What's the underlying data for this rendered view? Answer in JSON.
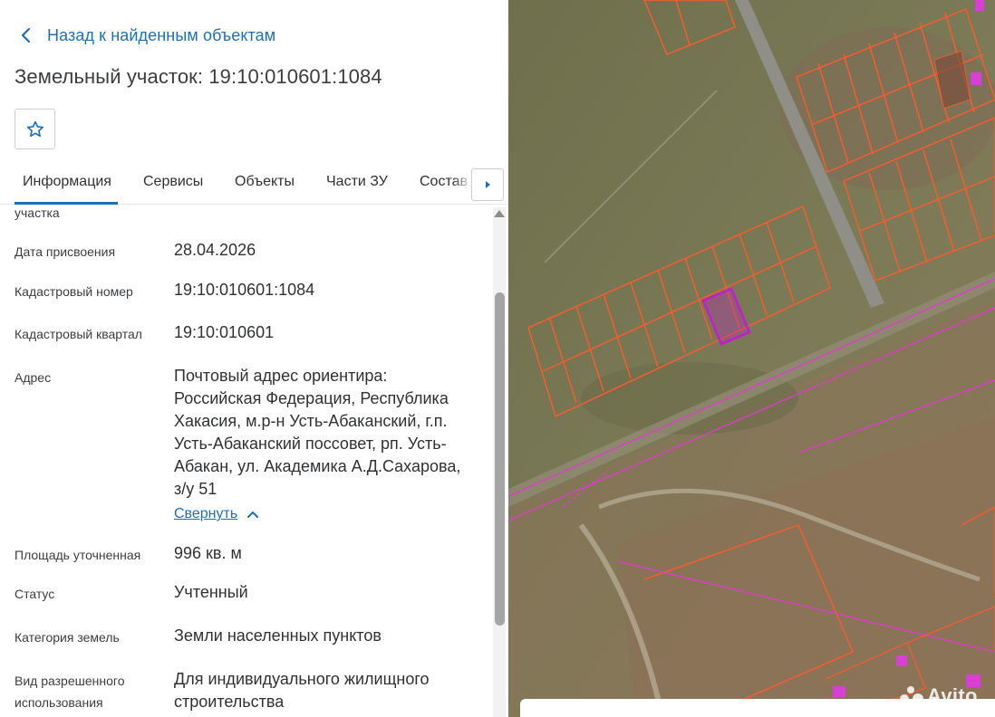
{
  "header": {
    "back_label": "Назад к найденным объектам",
    "title": "Земельный участок: 19:10:010601:1084"
  },
  "tabs": [
    {
      "label": "Информация",
      "active": true
    },
    {
      "label": "Сервисы"
    },
    {
      "label": "Объекты"
    },
    {
      "label": "Части ЗУ"
    },
    {
      "label": "Состав"
    }
  ],
  "info": {
    "cut_label": "участка",
    "rows": [
      {
        "label": "Дата присвоения",
        "value": "28.04.2026"
      },
      {
        "label": "Кадастровый номер",
        "value": "19:10:010601:1084"
      },
      {
        "label": "Кадастровый квартал",
        "value": "19:10:010601"
      },
      {
        "label": "Адрес",
        "value_lines": [
          "Почтовый адрес ориентира:",
          "Российская Федерация, Республика",
          "Хакасия, м.р-н Усть-Абаканский, г.п.",
          "Усть-Абаканский поссовет, рп. Усть-",
          "Абакан, ул. Академика А.Д.Сахарова,",
          "з/у 51"
        ]
      },
      {
        "label": "Площадь уточненная",
        "value": "996 кв. м"
      },
      {
        "label": "Статус",
        "value": "Учтенный"
      },
      {
        "label": "Категория земель",
        "value": "Земли населенных пунктов"
      },
      {
        "label_lines": [
          "Вид разрешенного",
          "использования"
        ],
        "value_lines": [
          "Для индивидуального жилищного",
          "строительства"
        ]
      }
    ],
    "collapse_label": "Свернуть"
  },
  "map": {
    "watermark": "Avito",
    "colors": {
      "parcel_outline": "#ff5a2a",
      "selected_parcel": "#c21fc8",
      "boundary_line": "#e23ad0"
    }
  },
  "icons": {
    "back": "chevron-left-icon",
    "favorite": "star-outline-icon",
    "tabs_next": "triangle-right-icon",
    "collapse": "chevron-up-icon",
    "scroll_up": "triangle-up-icon"
  },
  "colors": {
    "accent": "#1f6fb8",
    "text": "#2f3133"
  }
}
